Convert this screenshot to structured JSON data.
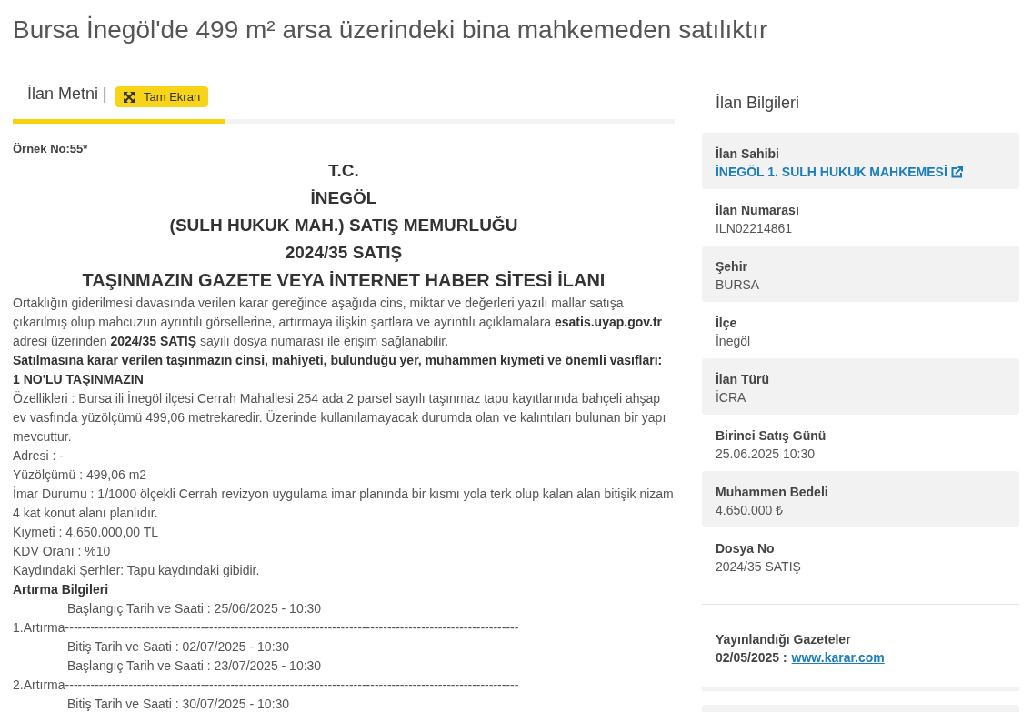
{
  "page_title": "Bursa İnegöl'de 499 m² arsa üzerindeki bina mahkemeden satılıktır",
  "tabs": [
    {
      "label": "İlan Metni |",
      "selected": true
    }
  ],
  "fullscreen_button": {
    "label": "Tam Ekran"
  },
  "document": {
    "sample_no": "Örnek No:55*",
    "headings": [
      "T.C.",
      "İNEGÖL",
      "(SULH HUKUK MAH.) SATIŞ MEMURLUĞU",
      "2024/35 SATIŞ",
      "TAŞINMAZIN GAZETE VEYA İNTERNET HABER SİTESİ İLANI"
    ],
    "paragraphs": [
      {
        "kind": "text",
        "text": "Ortaklığın giderilmesi davasında verilen karar gereğince aşağıda cins, miktar ve değerleri yazılı mallar satışa çıkarılmış olup mahcuzun ayrıntılı görsellerine, artırmaya ilişkin şartlara ve ayrıntılı açıklamalara **esatis.uyap.gov.tr** adresi üzerinden **2024/35 SATIŞ** sayılı dosya numarası ile erişim sağlanabilir."
      },
      {
        "kind": "bold",
        "text": "Satılmasına karar verilen taşınmazın cinsi, mahiyeti, bulunduğu yer, muhammen kıymeti ve önemli vasıfları:"
      },
      {
        "kind": "bold",
        "text": "1 NO'LU TAŞINMAZIN"
      },
      {
        "kind": "text",
        "text": "Özellikleri : Bursa ili İnegöl ilçesi Cerrah Mahallesi 254 ada 2 parsel sayılı taşınmaz tapu kayıtlarında bahçeli ahşap ev vasfında yüzölçümü 499,06 metrekaredir. Üzerinde kullanılamayacak durumda olan ve kalıntıları bulunan bir yapı mevcuttur."
      },
      {
        "kind": "text",
        "text": "Adresi : -"
      },
      {
        "kind": "text",
        "text": "Yüzölçümü : 499,06 m2"
      },
      {
        "kind": "text",
        "text": "İmar Durumu : 1/1000 ölçekli Cerrah revizyon uygulama imar planında bir kısmı yola terk olup kalan alan bitişik nizam 4 kat konut alanı planlıdır."
      },
      {
        "kind": "text",
        "text": "Kıymeti : 4.650.000,00 TL"
      },
      {
        "kind": "text",
        "text": "KDV Oranı : %10"
      },
      {
        "kind": "text",
        "text": "Kaydındaki Şerhler: Tapu kaydındaki gibidir."
      },
      {
        "kind": "bold",
        "text": "Artırma Bilgileri"
      }
    ],
    "auction_rounds": [
      {
        "start": "Başlangıç Tarih ve Saati : 25/06/2025 - 10:30",
        "label": "1.Artırma-----------------------------------------------------------------------------------------------------------",
        "end": "Bitiş Tarih ve Saati : 02/07/2025 - 10:30"
      },
      {
        "start": "Başlangıç Tarih ve Saati : 23/07/2025 - 10:30",
        "label": "2.Artırma-----------------------------------------------------------------------------------------------------------",
        "end": "Bitiş Tarih ve Saati : 30/07/2025 - 10:30"
      }
    ]
  },
  "sidebar": {
    "title": "İlan Bilgileri",
    "fields": [
      {
        "label": "İlan Sahibi",
        "value": "İNEGÖL 1. SULH HUKUK MAHKEMESİ",
        "kind": "link"
      },
      {
        "label": "İlan Numarası",
        "value": "ILN02214861",
        "kind": "text"
      },
      {
        "label": "Şehir",
        "value": "BURSA",
        "kind": "text"
      },
      {
        "label": "İlçe",
        "value": "İnegöl",
        "kind": "text"
      },
      {
        "label": "İlan Türü",
        "value": "İCRA",
        "kind": "text"
      },
      {
        "label": "Birinci Satış Günü",
        "value": "25.06.2025 10:30",
        "kind": "text"
      },
      {
        "label": "Muhammen Bedeli",
        "value": "4.650.000 ₺",
        "kind": "text"
      },
      {
        "label": "Dosya No",
        "value": "2024/35 SATIŞ",
        "kind": "text"
      }
    ],
    "newspapers": {
      "title": "Yayınlandığı Gazeteler",
      "date": "02/05/2025 :",
      "link": "www.karar.com"
    }
  }
}
